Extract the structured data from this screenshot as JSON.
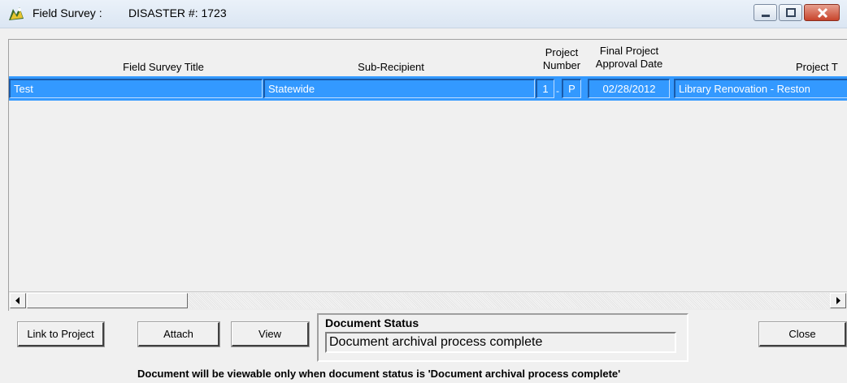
{
  "window": {
    "title": "Field Survey :",
    "subtitle": "DISASTER #: 1723"
  },
  "grid": {
    "columns": [
      {
        "label": "Field Survey Title"
      },
      {
        "label": "Sub-Recipient"
      },
      {
        "label_line1": "Project",
        "label_line2": "Number"
      },
      {
        "label_line1": "Final Project",
        "label_line2": "Approval Date"
      },
      {
        "label": "Project T"
      }
    ],
    "rows": [
      {
        "title": "Test",
        "sub_recipient": "Statewide",
        "project_number": "1",
        "project_sep": "-",
        "project_suffix": "P",
        "approval_date": "02/28/2012",
        "project_title": "Library Renovation - Reston"
      }
    ]
  },
  "buttons": {
    "link": "Link to Project",
    "attach": "Attach",
    "view": "View",
    "close": "Close"
  },
  "document_status": {
    "label": "Document Status",
    "value": "Document archival process complete"
  },
  "note": "Document will be viewable only when document status is 'Document archival process complete'",
  "colors": {
    "selection": "#3399ff",
    "window_bg": "#f0f0f0"
  }
}
